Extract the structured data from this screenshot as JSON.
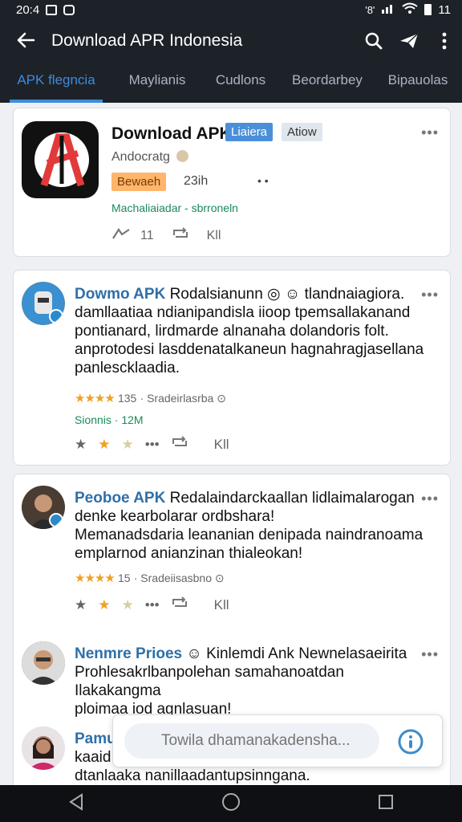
{
  "status": {
    "time": "20:4",
    "left_marker": "8",
    "signal": "'8'",
    "battery": "11"
  },
  "appbar": {
    "title": "Download APR Indonesia"
  },
  "tabs": [
    {
      "label": "APK flegncia"
    },
    {
      "label": "Maylianis"
    },
    {
      "label": "Cudlons"
    },
    {
      "label": "Beordarbey"
    },
    {
      "label": "Bipauolas"
    }
  ],
  "app_card": {
    "title": "Download APK",
    "badge_primary": "Liaiera",
    "badge_secondary": "Atiow",
    "subtitle": "Andocratg",
    "tag": "Bewaeh",
    "tag_time": "23ih",
    "dots": "• •",
    "link": "Machaliaiadar - sbrroneln",
    "boost_count": "11",
    "share_label": "Kll",
    "menu": "•••"
  },
  "posts": [
    {
      "name": "Dowmo APK",
      "lines": [
        "Rodalsianunn ◎ ☺ tlandnaiagiora.",
        "damllaatiaa ndianipandisla iioop tpemsallakanand",
        "pontianard, lirdmarde alnanaha dolandoris folt.",
        "anprotodesi lasddenatalkaneun hagnahragjasellana",
        "panlescklaadia."
      ],
      "rating_value": "135",
      "rating_text": "Sradeirlasrba ⊙",
      "stats": "Sionnis · 12M",
      "reply_label": "Kll"
    },
    {
      "name": "Peoboe APK",
      "lines": [
        "Redalaindarckaallan lidlaimalarogan",
        "denke kearbolarar ordbshara!",
        "Memanadsdaria leananian denipada naindranoama",
        "emplarnod anianzinan thialeokan!"
      ],
      "rating_value": "15",
      "rating_text": "Sradeiisasbno ⊙",
      "reply_label": "Kll"
    },
    {
      "name": "Nenmre Prioes",
      "lines": [
        "☺ Kinlemdi Ank Newnelasaeirita",
        "Prohlesakrlbanpolehan samahanoatdan Ilakakangma",
        "ploimaa iod agnlasuan!"
      ]
    },
    {
      "name": "Pamu",
      "lines": [
        "kaaid",
        "dtanlaaka nanillaadantupsinngana."
      ]
    }
  ],
  "search": {
    "placeholder": "Towila dhamanakadensha..."
  },
  "colors": {
    "accent": "#3d8cdc",
    "appbar": "#1d2229",
    "star": "#f0a020",
    "badge_blue": "#4a90d9",
    "tag_orange": "#ffb56b"
  }
}
